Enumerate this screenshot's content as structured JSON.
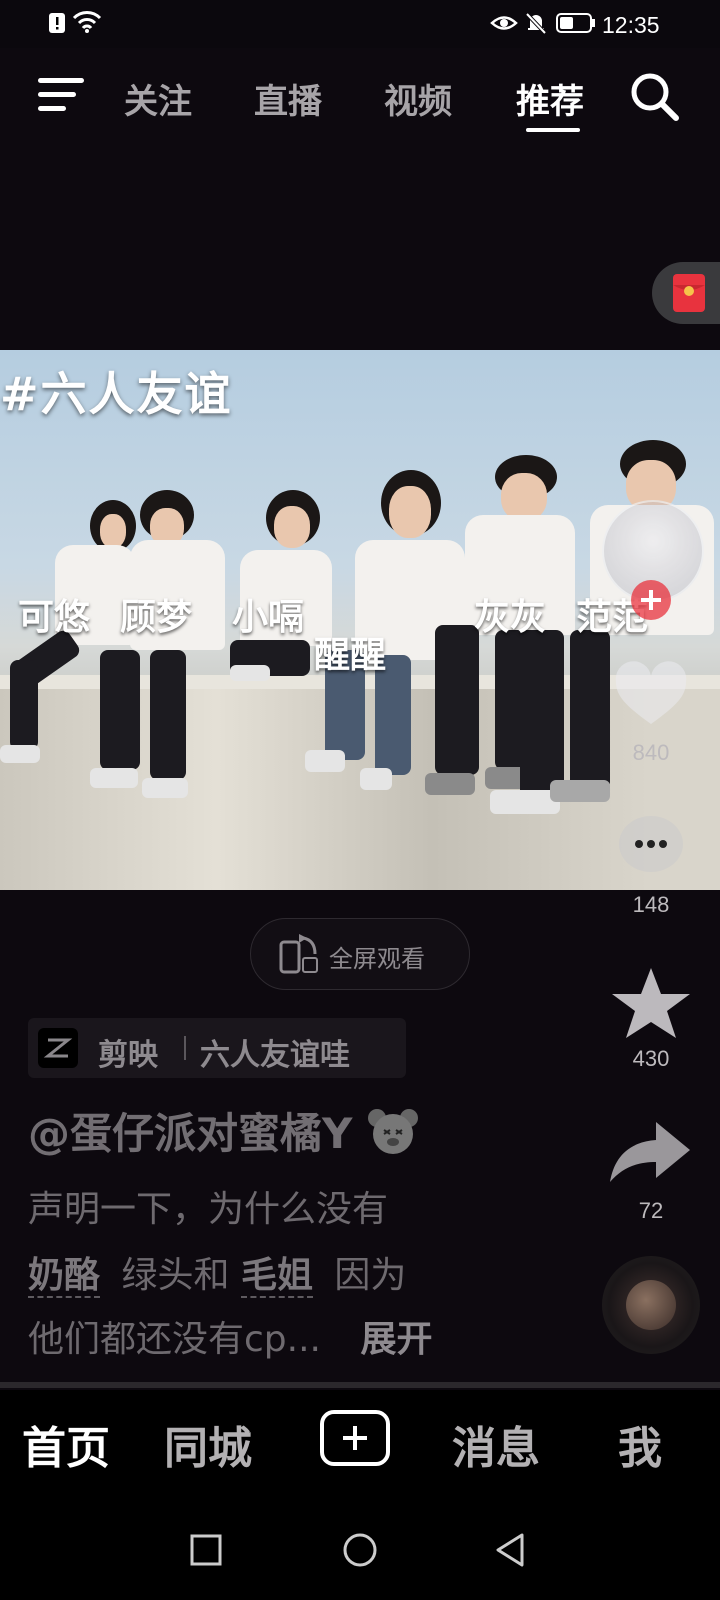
{
  "status_bar": {
    "time": "12:35"
  },
  "top_nav": {
    "tabs": [
      {
        "label": "关注"
      },
      {
        "label": "直播"
      },
      {
        "label": "视频"
      },
      {
        "label": "推荐",
        "active": true
      }
    ]
  },
  "video": {
    "hashtag": "#六人友谊",
    "names": [
      "可悠",
      "顾梦",
      "小嗝",
      "醒醒",
      "灰灰",
      "范范"
    ]
  },
  "fullscreen_label": "全屏观看",
  "right_rail": {
    "like_count": "840",
    "comment_count": "148",
    "favorite_count": "430",
    "share_count": "72"
  },
  "source_tag": {
    "app": "剪映",
    "template": "六人友谊哇"
  },
  "post": {
    "author": "@蛋仔派对蜜橘Y",
    "caption_line1": "声明一下，为什么没有",
    "mention1": "奶酪",
    "caption_mid": "绿头和",
    "mention2": "毛姐",
    "caption_end": "因为",
    "caption_line3": "他们都还没有cp...",
    "expand": "展开"
  },
  "bottom_nav": {
    "items": [
      "首页",
      "同城",
      "消息",
      "我"
    ],
    "active": "首页"
  },
  "colors": {
    "background": "#0d090f",
    "accent_red": "#e8333e"
  }
}
